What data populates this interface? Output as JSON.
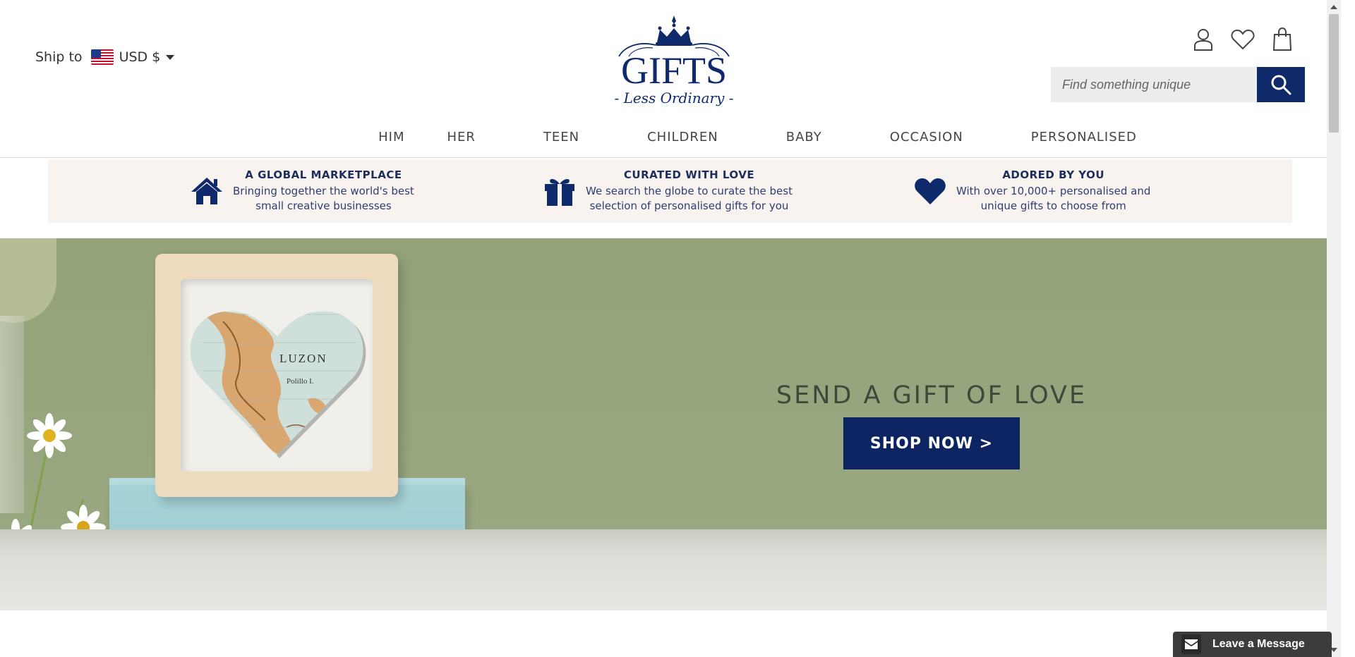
{
  "header": {
    "ship_label": "Ship to",
    "currency": "USD $",
    "flag": "us-flag-icon",
    "search_placeholder": "Find something unique"
  },
  "logo": {
    "main": "GIFTS",
    "sub": "- Less Ordinary -"
  },
  "nav": {
    "items": [
      "HIM",
      "HER",
      "TEEN",
      "CHILDREN",
      "BABY",
      "OCCASION",
      "PERSONALISED"
    ]
  },
  "usp": [
    {
      "icon": "home-icon",
      "title": "A GLOBAL MARKETPLACE",
      "line1": "Bringing together the world's best",
      "line2": "small creative businesses"
    },
    {
      "icon": "gift-icon",
      "title": "CURATED WITH LOVE",
      "line1": "We search the globe to curate the best",
      "line2": "selection of personalised gifts for you"
    },
    {
      "icon": "heart-icon",
      "title": "ADORED BY YOU",
      "line1": "With over 10,000+ personalised and",
      "line2": "unique gifts to choose from"
    }
  ],
  "hero": {
    "title": "SEND A GIFT OF LOVE",
    "cta": "SHOP NOW >",
    "map_label_1": "LUZON",
    "map_label_2": "Polillo I."
  },
  "chat": {
    "label": "Leave a Message"
  },
  "colors": {
    "brand_navy": "#0f2a6b",
    "usp_bg": "#f8f3ef",
    "hero_bg": "#95a47d"
  }
}
